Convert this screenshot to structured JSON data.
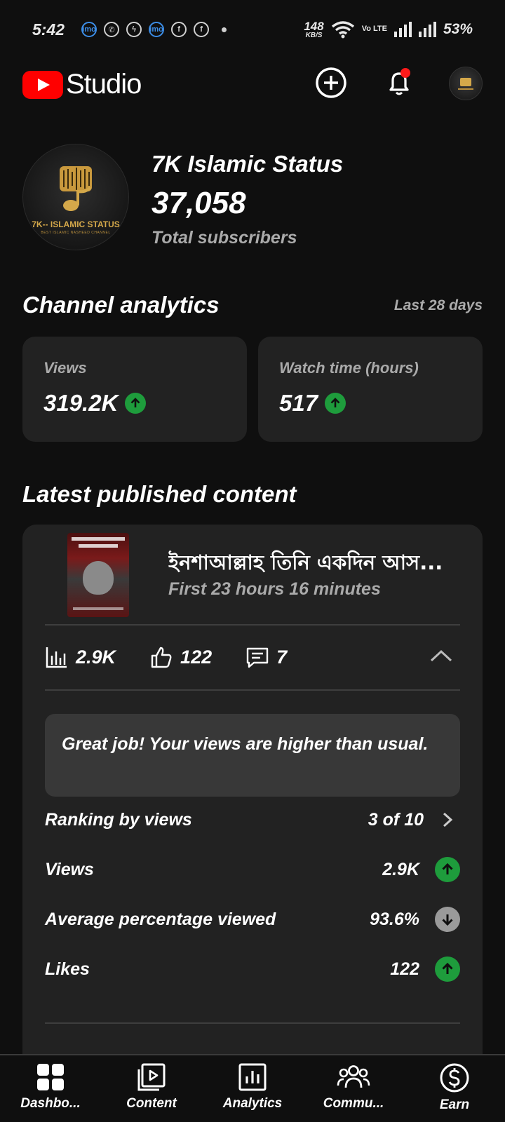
{
  "status_bar": {
    "time": "5:42",
    "net_speed": "148",
    "net_speed_unit": "KB/S",
    "volte": "Vo LTE",
    "battery": "53%"
  },
  "header": {
    "app_name": "Studio",
    "brand_color": "#ff0000"
  },
  "channel": {
    "name": "7K Islamic Status",
    "subscribers": "37,058",
    "subscribers_label": "Total subscribers",
    "avatar_text": "7K-- ISLAMIC STATUS",
    "avatar_subtext": "BEST ISLAMIC NASHEED CHANNEL"
  },
  "analytics": {
    "title": "Channel analytics",
    "period": "Last 28 days",
    "cards": [
      {
        "label": "Views",
        "value": "319.2K",
        "trend": "up"
      },
      {
        "label": "Watch time (hours)",
        "value": "517",
        "trend": "up"
      }
    ]
  },
  "latest": {
    "title": "Latest published content",
    "video_title": "ইনশাআল্লাহ তিনি  একদিন আস...",
    "video_meta": "First 23 hours 16 minutes",
    "stats": {
      "views": "2.9K",
      "likes": "122",
      "comments": "7"
    },
    "message": "Great job! Your views are higher than usual.",
    "rows": [
      {
        "label": "Ranking by views",
        "value": "3 of 10",
        "indicator": "chevron"
      },
      {
        "label": "Views",
        "value": "2.9K",
        "indicator": "up"
      },
      {
        "label": "Average percentage viewed",
        "value": "93.6%",
        "indicator": "down"
      },
      {
        "label": "Likes",
        "value": "122",
        "indicator": "up"
      }
    ]
  },
  "nav": {
    "items": [
      {
        "label": "Dashbo...",
        "icon": "dashboard-icon"
      },
      {
        "label": "Content",
        "icon": "content-icon"
      },
      {
        "label": "Analytics",
        "icon": "analytics-icon"
      },
      {
        "label": "Commu...",
        "icon": "community-icon"
      },
      {
        "label": "Earn",
        "icon": "earn-icon"
      }
    ]
  },
  "colors": {
    "background": "#0f0f0f",
    "card": "#222222",
    "trend_up": "#1e9c3c",
    "trend_down": "#9a9a9a",
    "notification_dot": "#ff1a1a"
  }
}
